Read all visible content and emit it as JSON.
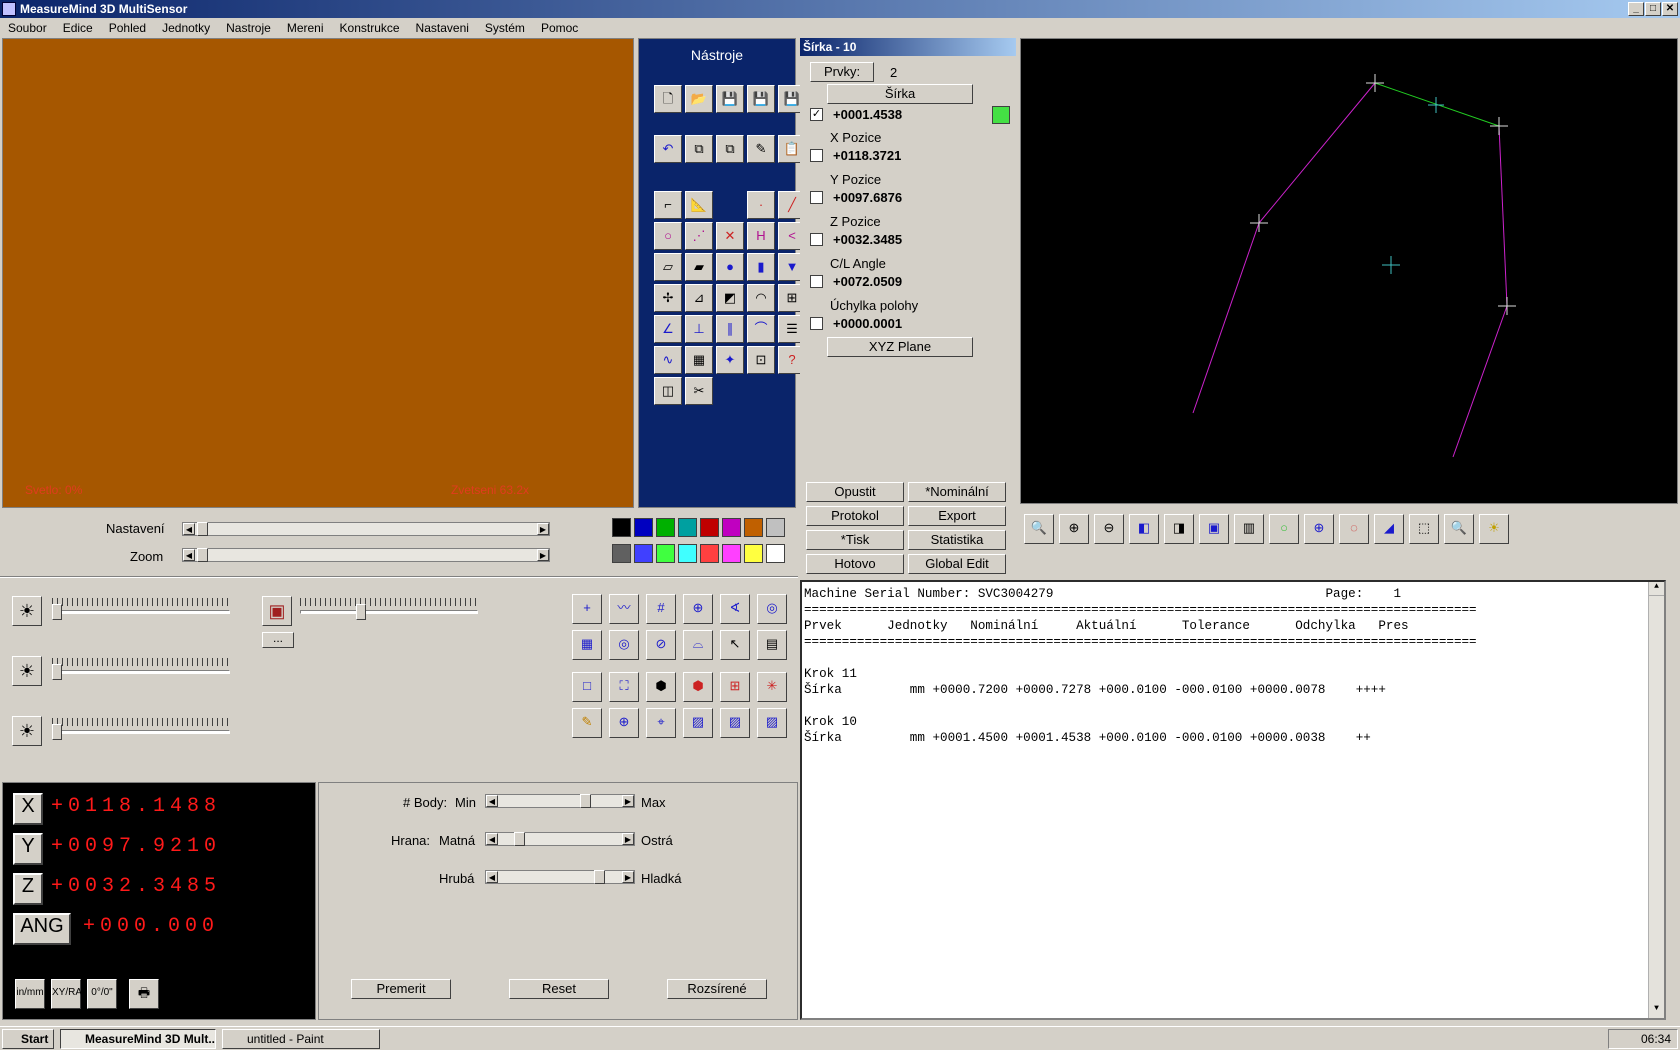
{
  "window": {
    "title": "MeasureMind 3D MultiSensor"
  },
  "menu": [
    "Soubor",
    "Edice",
    "Pohled",
    "Jednotky",
    "Nastroje",
    "Mereni",
    "Konstrukce",
    "Nastaveni",
    "Systém",
    "Pomoc"
  ],
  "camera": {
    "light_label": "Svetlo: 0%",
    "zoom_label": "Zvetseni 63.2x"
  },
  "tools_panel": {
    "title": "Nástroje"
  },
  "feature": {
    "header": "Šírka - 10",
    "prvky_label": "Prvky:",
    "prvky_count": "2",
    "type_button": "Šírka",
    "main_value": "+0001.4538",
    "main_checked": true,
    "status_color": "#44e044",
    "rows": [
      {
        "label": "X Pozice",
        "value": "+0118.3721"
      },
      {
        "label": "Y Pozice",
        "value": "+0097.6876"
      },
      {
        "label": "Z Pozice",
        "value": "+0032.3485"
      },
      {
        "label": "C/L Angle",
        "value": "+0072.0509"
      },
      {
        "label": "Úchylka polohy",
        "value": "+0000.0001"
      }
    ],
    "plane_button": "XYZ Plane",
    "buttons": [
      "Opustit",
      "*Nominální",
      "Protokol",
      "Export",
      "*Tisk",
      "Statistika",
      "Hotovo",
      "Global Edit"
    ]
  },
  "sliders": {
    "nastaveni_label": "Nastavení",
    "zoom_label": "Zoom"
  },
  "palette": [
    "#000000",
    "#0000c0",
    "#00b000",
    "#00a0a0",
    "#c00000",
    "#c000c0",
    "#c06000",
    "#c0c0c0",
    "#606060",
    "#4040ff",
    "#40ff40",
    "#40ffff",
    "#ff4040",
    "#ff40ff",
    "#ffff40",
    "#ffffff"
  ],
  "report": {
    "serial_line": "Machine Serial Number: SVC3004279",
    "page_label": "Page:    1",
    "columns": [
      "Prvek",
      "Jednotky",
      "Nominální",
      "Aktuální",
      "Tolerance",
      "Odchylka",
      "Pres"
    ],
    "entries": [
      {
        "step": "Krok 11",
        "name": "Šírka",
        "units": "mm",
        "nominal": "+0000.7200",
        "actual": "+0000.7278",
        "tol_plus": "+000.0100",
        "tol_minus": "-000.0100",
        "deviation": "+0000.0078",
        "pres": "++++"
      },
      {
        "step": "Krok 10",
        "name": "Šírka",
        "units": "mm",
        "nominal": "+0001.4500",
        "actual": "+0001.4538",
        "tol_plus": "+000.0100",
        "tol_minus": "-000.0100",
        "deviation": "+0000.0038",
        "pres": "++"
      }
    ]
  },
  "dro": {
    "axes": [
      {
        "label": "X",
        "value": "+0118.1488"
      },
      {
        "label": "Y",
        "value": "+0097.9210"
      },
      {
        "label": "Z",
        "value": "+0032.3485"
      },
      {
        "label": "ANG",
        "value": "+000.000"
      }
    ]
  },
  "edge_settings": {
    "body_label": "# Body:",
    "body_min": "Min",
    "body_max": "Max",
    "hrana_label": "Hrana:",
    "hrana_min": "Matná",
    "hrana_max": "Ostrá",
    "hruba_min": "Hrubá",
    "hruba_max": "Hladká",
    "buttons": [
      "Premerit",
      "Reset",
      "Rozsírené"
    ]
  },
  "taskbar": {
    "start": "Start",
    "tasks": [
      "MeasureMind 3D Mult...",
      "untitled - Paint"
    ],
    "clock": "06:34"
  }
}
